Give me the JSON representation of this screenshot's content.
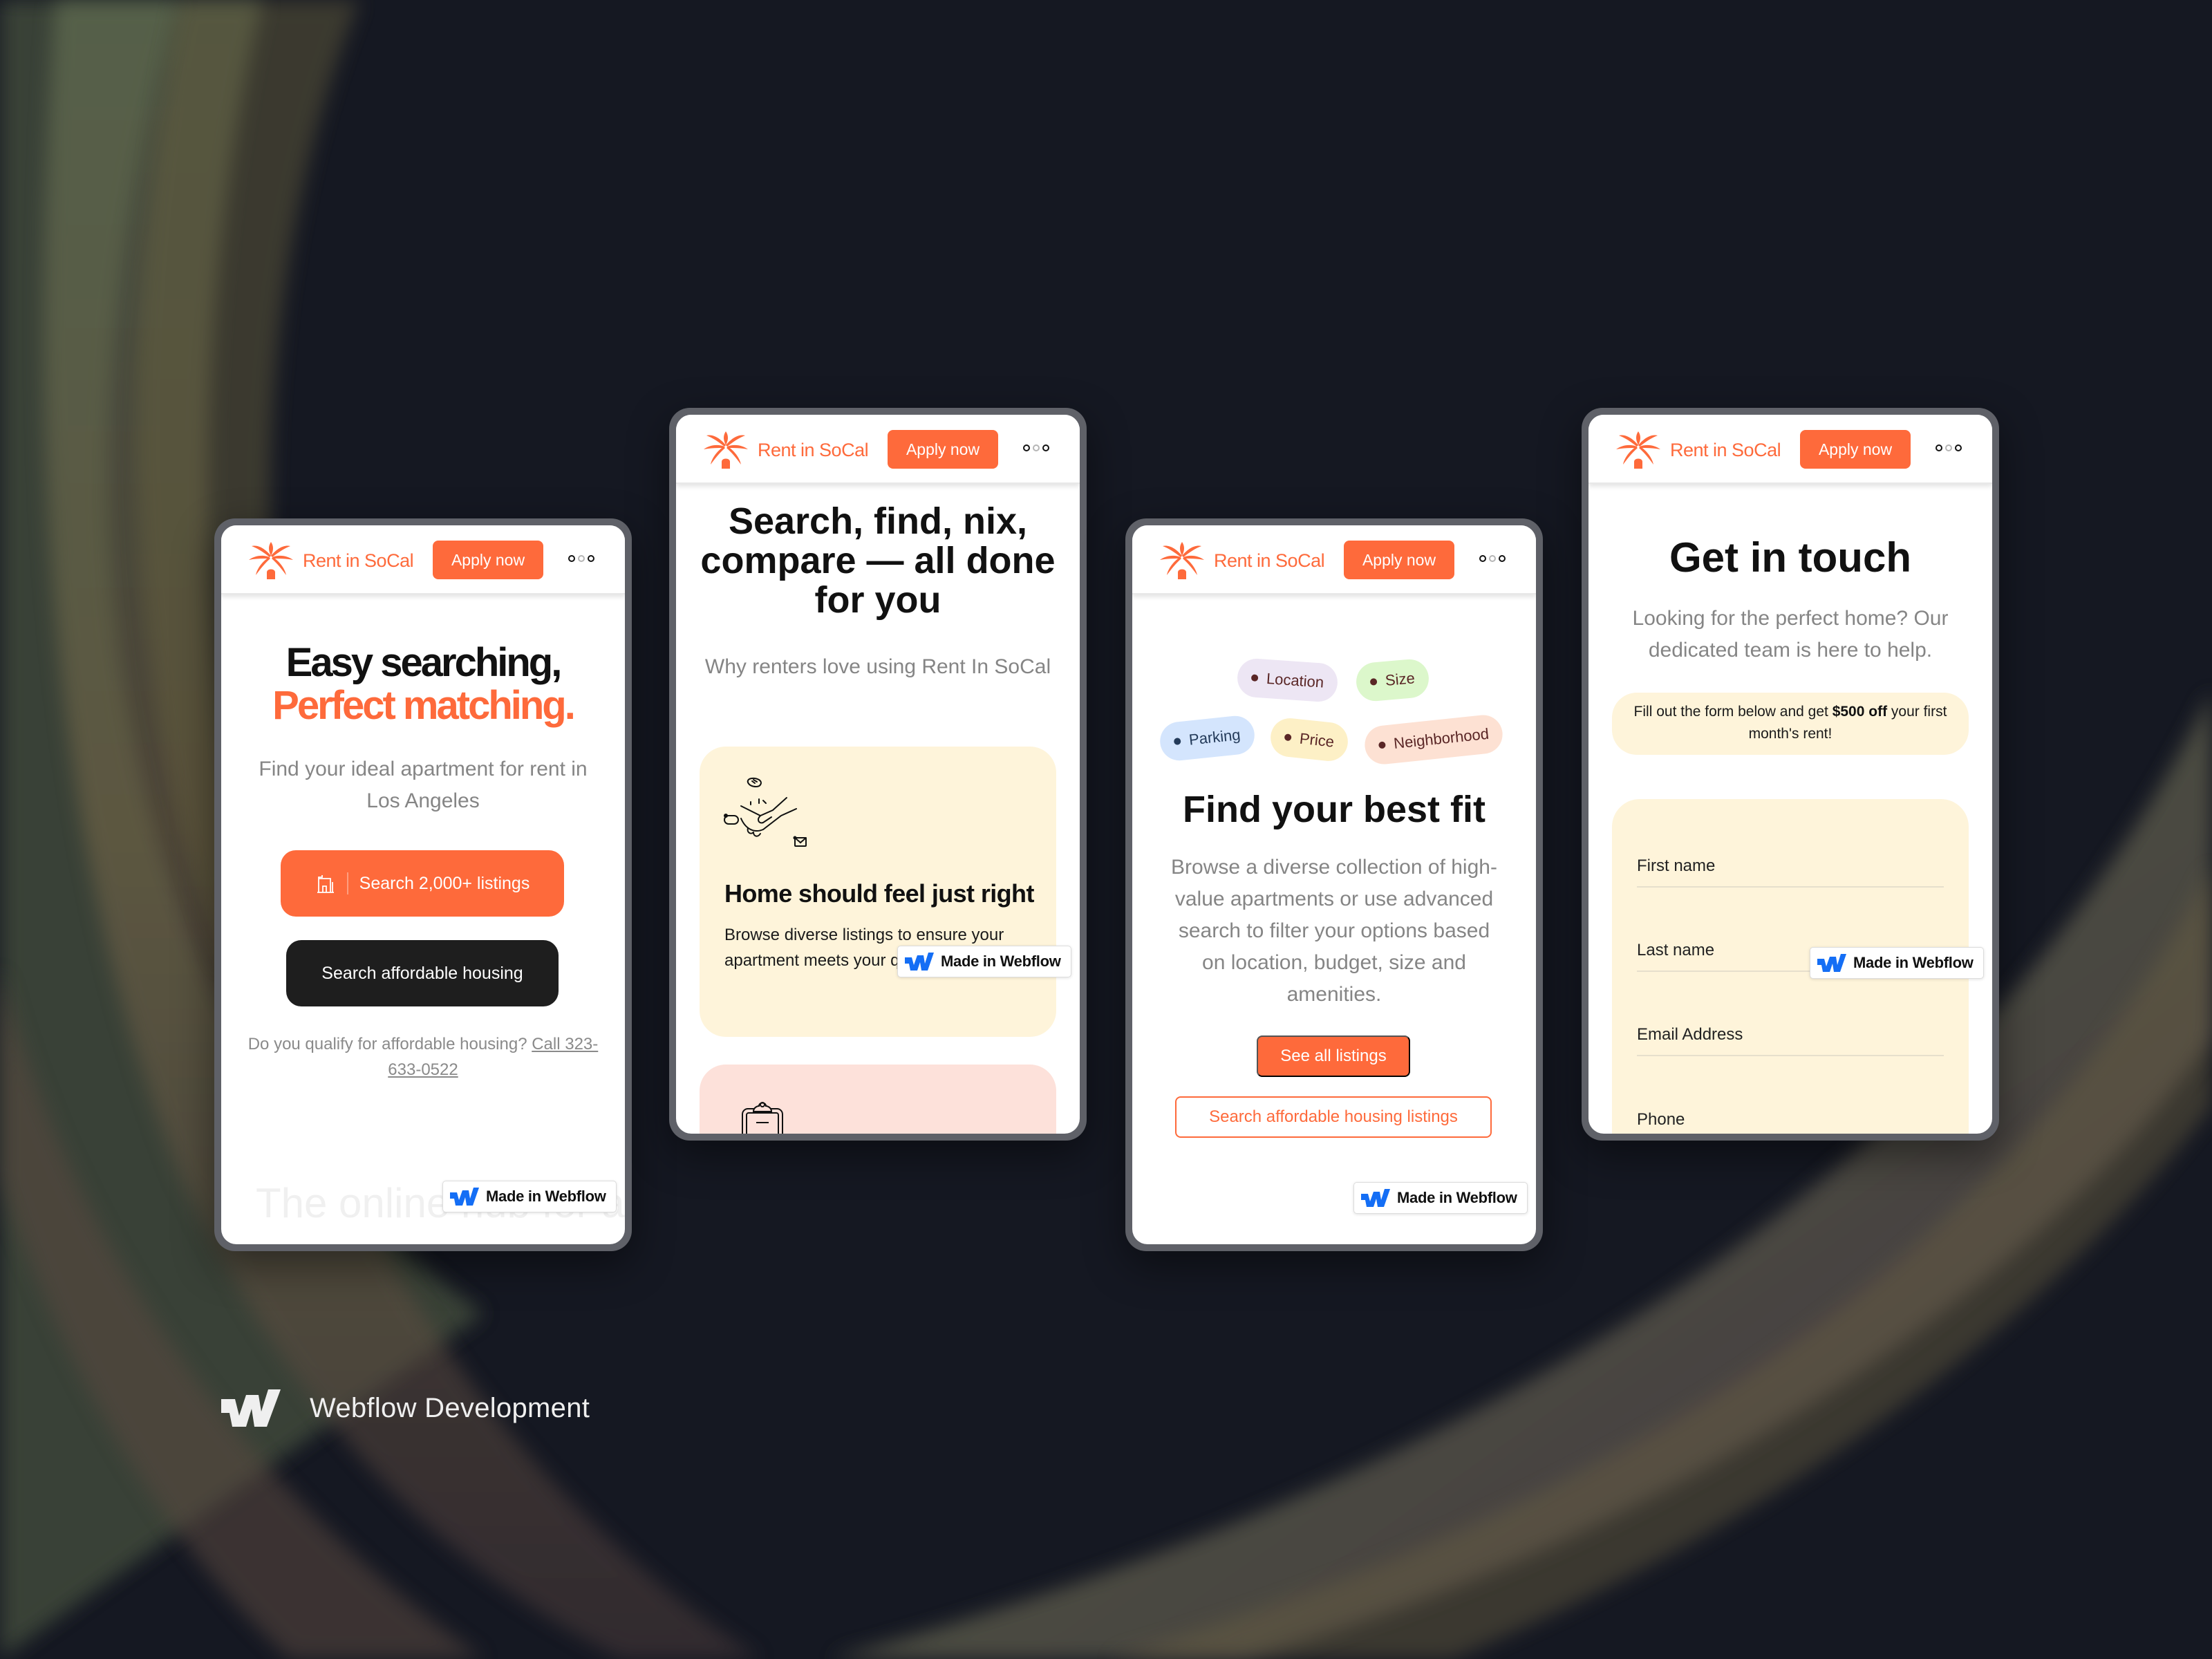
{
  "colors": {
    "brand_orange": "#fe6a3b",
    "card_cream": "#fef4da",
    "card_pink": "#fde1da",
    "webflow_blue": "#146ef5",
    "frame_grey": "#5f6168",
    "background": "#151822"
  },
  "nav": {
    "logo_icon": "palm-tree-house-icon",
    "brand_name": "Rent in SoCal",
    "apply_label": "Apply now",
    "menu_icon": "three-dots-menu-icon"
  },
  "badge": {
    "icon": "webflow-logo-icon",
    "label": "Made in Webflow"
  },
  "phones": [
    {
      "hero_title_line1": "Easy searching,",
      "hero_title_line2": "Perfect matching.",
      "subtitle": "Find your ideal apartment for rent in Los Angeles",
      "search_button": {
        "icon": "building-icon",
        "label": "Search 2,000+ listings"
      },
      "affordable_button": "Search affordable housing",
      "qualify_text": "Do you qualify for affordable housing?",
      "qualify_link": "Call 323-633-0522",
      "faded_text": "The online hub for apartment rentals"
    },
    {
      "title": "Search, find, nix, compare — all done for you",
      "subtitle": "Why renters love using Rent In SoCal",
      "cards": [
        {
          "icon": "handshake-illustration",
          "title": "Home should feel just right",
          "body": "Browse diverse listings to ensure your apartment meets your qualifications"
        },
        {
          "icon": "clipboard-illustration"
        }
      ]
    },
    {
      "tags": [
        "Location",
        "Size",
        "Parking",
        "Price",
        "Neighborhood"
      ],
      "title": "Find your best fit",
      "body": "Browse a diverse collection of high-value apartments or use advanced search to filter your options based on location, budget, size and amenities.",
      "primary_button": "See all listings",
      "secondary_button": "Search affordable housing listings"
    },
    {
      "title": "Get in touch",
      "subtitle": "Looking for the perfect home? Our dedicated team is here to help.",
      "promo_before": "Fill out the form below and get ",
      "promo_bold": "$500 off",
      "promo_after": " your first month's rent!",
      "form_fields": [
        {
          "placeholder": "First name",
          "value": ""
        },
        {
          "placeholder": "Last name",
          "value": ""
        },
        {
          "placeholder": "Email Address",
          "value": ""
        },
        {
          "placeholder": "Phone",
          "value": ""
        }
      ]
    }
  ],
  "footer": {
    "logo_icon": "webflow-logo-icon",
    "label": "Webflow Development"
  }
}
